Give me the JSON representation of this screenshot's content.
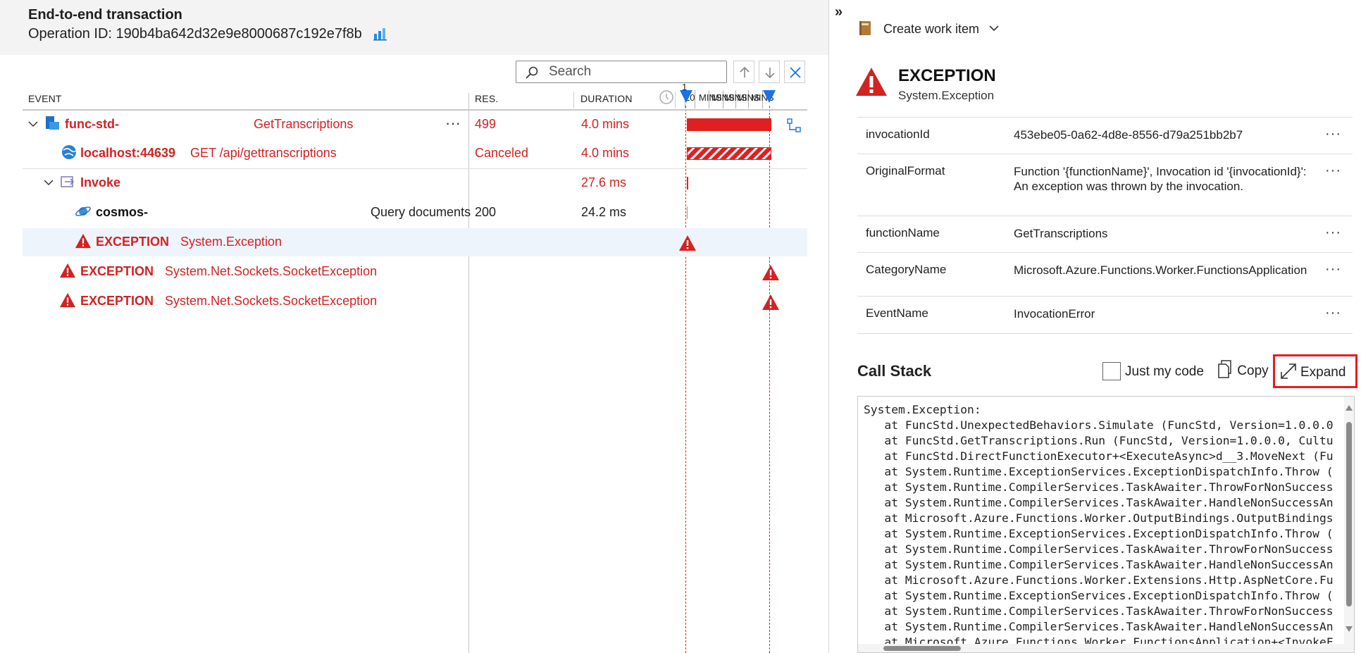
{
  "header": {
    "title": "End-to-end transaction",
    "operation_label": "Operation ID: 190b4ba642d32e9e8000687c192e7f8b"
  },
  "search": {
    "placeholder": "Search"
  },
  "columns": {
    "event": "EVENT",
    "res": "RES.",
    "duration": "DURATION"
  },
  "timeline": {
    "labels": [
      "1",
      "20",
      "MINS",
      "MINS",
      "MINS",
      "MINS",
      "MINS"
    ]
  },
  "rows": [
    {
      "name": "func-std-",
      "detail": "GetTranscriptions",
      "res": "499",
      "duration": "4.0 mins",
      "icon": "function-app-icon",
      "more": "···"
    },
    {
      "name": "localhost:44639",
      "detail": "GET /api/gettranscriptions",
      "res": "Canceled",
      "duration": "4.0 mins",
      "icon": "globe-icon"
    },
    {
      "name": "Invoke",
      "detail": "",
      "res": "",
      "duration": "27.6 ms",
      "icon": "invoke-icon"
    },
    {
      "name": "cosmos-",
      "detail": "Query documents",
      "res": "200",
      "duration": "24.2 ms",
      "icon": "cosmos-db-icon"
    },
    {
      "name": "EXCEPTION",
      "detail": "System.Exception",
      "res": "",
      "duration": "",
      "icon": "warning-icon"
    },
    {
      "name": "EXCEPTION",
      "detail": "System.Net.Sockets.SocketException",
      "res": "",
      "duration": "",
      "icon": "warning-icon"
    },
    {
      "name": "EXCEPTION",
      "detail": "System.Net.Sockets.SocketException",
      "res": "",
      "duration": "",
      "icon": "warning-icon"
    }
  ],
  "details": {
    "collapse_glyph": "»",
    "create_work_item": "Create work item",
    "exception_title": "EXCEPTION",
    "exception_type": "System.Exception",
    "properties": [
      {
        "key": "invocationId",
        "value": "453ebe05-0a62-4d8e-8556-d79a251bb2b7"
      },
      {
        "key": "OriginalFormat",
        "value": "Function '{functionName}', Invocation id '{invocationId}': An exception was thrown by the invocation."
      },
      {
        "key": "functionName",
        "value": "GetTranscriptions"
      },
      {
        "key": "CategoryName",
        "value": "Microsoft.Azure.Functions.Worker.FunctionsApplication"
      },
      {
        "key": "EventName",
        "value": "InvocationError"
      }
    ],
    "more_glyph": "···",
    "call_stack_title": "Call Stack",
    "just_my_code": "Just my code",
    "copy": "Copy",
    "expand": "Expand",
    "call_stack": "System.Exception:\n   at FuncStd.UnexpectedBehaviors.Simulate (FuncStd, Version=1.0.0.0\n   at FuncStd.GetTranscriptions.Run (FuncStd, Version=1.0.0.0, Cultu\n   at FuncStd.DirectFunctionExecutor+<ExecuteAsync>d__3.MoveNext (Fu\n   at System.Runtime.ExceptionServices.ExceptionDispatchInfo.Throw (\n   at System.Runtime.CompilerServices.TaskAwaiter.ThrowForNonSuccess\n   at System.Runtime.CompilerServices.TaskAwaiter.HandleNonSuccessAn\n   at Microsoft.Azure.Functions.Worker.OutputBindings.OutputBindings\n   at System.Runtime.ExceptionServices.ExceptionDispatchInfo.Throw (\n   at System.Runtime.CompilerServices.TaskAwaiter.ThrowForNonSuccess\n   at System.Runtime.CompilerServices.TaskAwaiter.HandleNonSuccessAn\n   at Microsoft.Azure.Functions.Worker.Extensions.Http.AspNetCore.Fu\n   at System.Runtime.ExceptionServices.ExceptionDispatchInfo.Throw (\n   at System.Runtime.CompilerServices.TaskAwaiter.ThrowForNonSuccess\n   at System.Runtime.CompilerServices.TaskAwaiter.HandleNonSuccessAn\n   at Microsoft.Azure.Functions.Worker.FunctionsApplication+<InvokeF"
  },
  "colors": {
    "error": "#d32222",
    "accent": "#1a73e8",
    "selected_row": "#eef4fb"
  }
}
